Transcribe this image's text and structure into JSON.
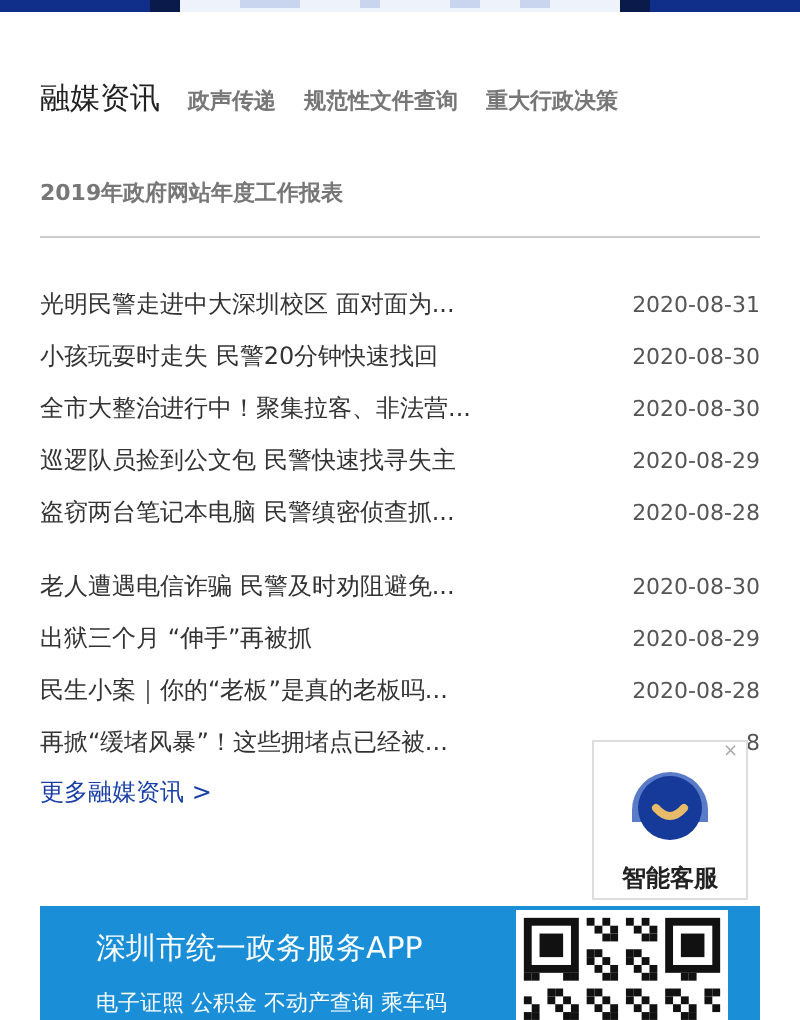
{
  "tabs": [
    {
      "label": "融媒资讯",
      "selected": true
    },
    {
      "label": "政声传递",
      "selected": false
    },
    {
      "label": "规范性文件查询",
      "selected": false
    },
    {
      "label": "重大行政决策",
      "selected": false
    },
    {
      "label": "2019年政府网站年度工作报表",
      "selected": false
    }
  ],
  "news_groups": [
    [
      {
        "title": "光明民警走进中大深圳校区 面对面为...",
        "date": "2020-08-31"
      },
      {
        "title": "小孩玩耍时走失 民警20分钟快速找回",
        "date": "2020-08-30"
      },
      {
        "title": "全市大整治进行中！聚集拉客、非法营...",
        "date": "2020-08-30"
      },
      {
        "title": "巡逻队员捡到公文包 民警快速找寻失主",
        "date": "2020-08-29"
      },
      {
        "title": "盗窃两台笔记本电脑 民警缜密侦查抓...",
        "date": "2020-08-28"
      }
    ],
    [
      {
        "title": "老人遭遇电信诈骗 民警及时劝阻避免...",
        "date": "2020-08-30"
      },
      {
        "title": "出狱三个月 “伸手”再被抓",
        "date": "2020-08-29"
      },
      {
        "title": "民生小案｜你的“老板”是真的老板吗...",
        "date": "2020-08-28"
      },
      {
        "title": "再掀“缓堵风暴”！这些拥堵点已经被...",
        "date": "8"
      }
    ]
  ],
  "more_link": "更多融媒资讯 >",
  "service_widget": {
    "label": "智能客服",
    "close": "×"
  },
  "app_banner": {
    "title": "深圳市统一政务服务APP",
    "subtitle": "电子证照 公积金 不动产查询 乘车码"
  }
}
